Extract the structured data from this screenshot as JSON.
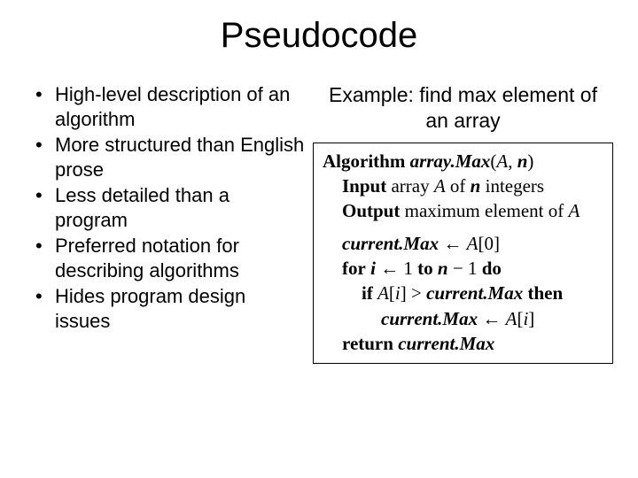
{
  "title": "Pseudocode",
  "bullets": [
    "High-level description of an algorithm",
    "More structured than English prose",
    "Less detailed than a program",
    "Preferred notation for describing algorithms",
    "Hides program design issues"
  ],
  "example": {
    "heading": "Example: find max element of an array",
    "alg_head_kw": "Algorithm",
    "alg_name": "array.Max",
    "alg_params_open": "(",
    "alg_param1": "A",
    "alg_param_sep": ", ",
    "alg_param2": "n",
    "alg_params_close": ")",
    "input_kw": "Input",
    "input_text1": " array ",
    "input_A": "A",
    "input_text2": " of ",
    "input_n": "n",
    "input_text3": " integers",
    "output_kw": "Output",
    "output_text1": " maximum element of ",
    "output_A": "A",
    "cm": "current.Max",
    "assign": " ← ",
    "A0": "A",
    "br_open": "[",
    "zero": "0",
    "br_close": "]",
    "for_kw": "for",
    "i": "i",
    "one": " 1 ",
    "to_kw": "to",
    "n": "n",
    "minus": " − ",
    "one2": "1 ",
    "do_kw": "do",
    "if_kw": "if",
    "Ai_A": "A",
    "Ai_i": "i",
    "gt": " > ",
    "then_kw": "then",
    "return_kw": "return"
  }
}
